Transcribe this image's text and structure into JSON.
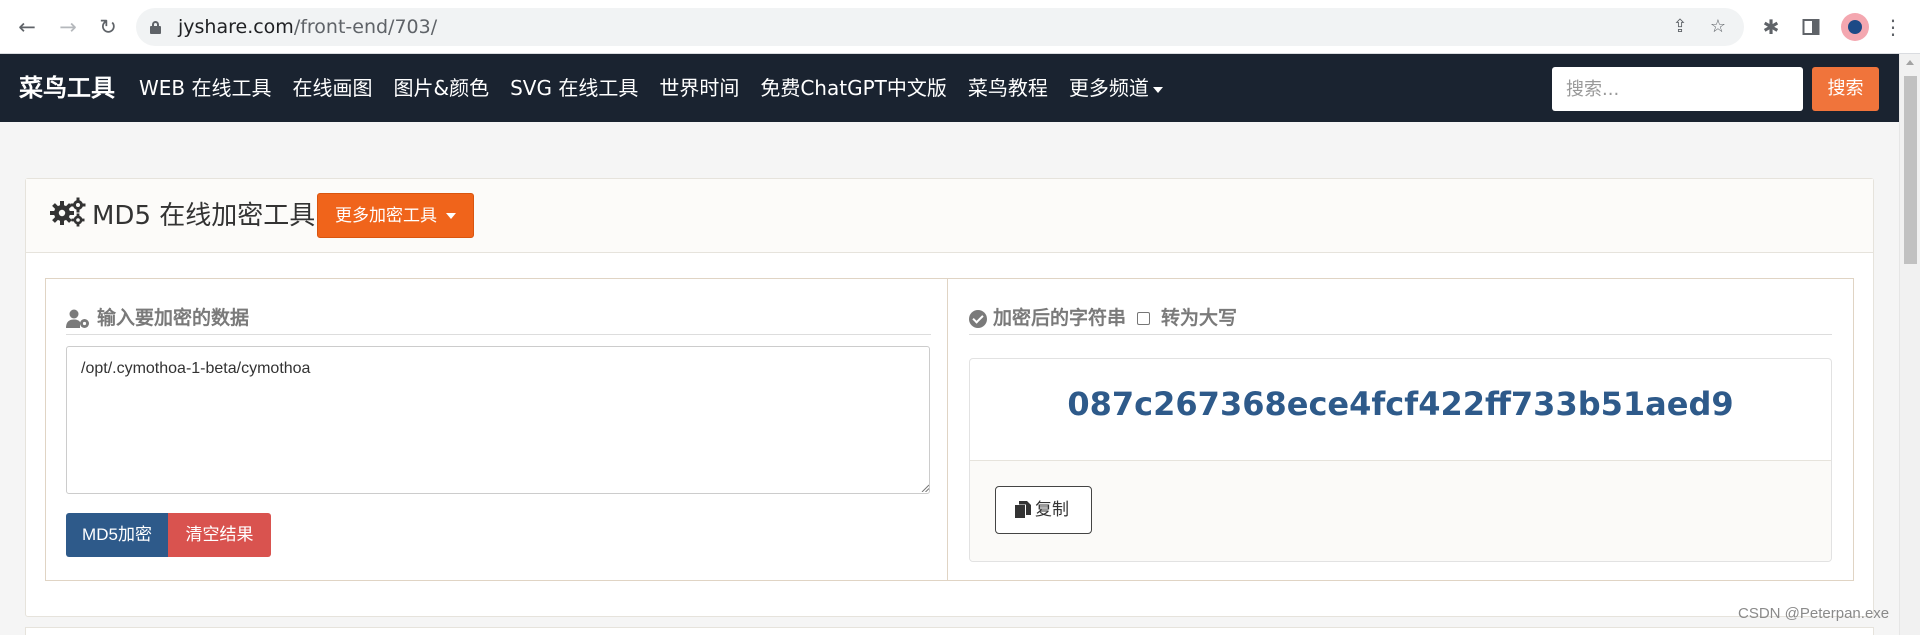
{
  "browser": {
    "url_domain": "jyshare.com",
    "url_path": "/front-end/703/",
    "back_glyph": "←",
    "forward_glyph": "→",
    "reload_glyph": "↻",
    "share_glyph": "⇪",
    "star_glyph": "☆",
    "extensions_glyph": "✱",
    "menu_glyph": "⋮"
  },
  "navbar": {
    "brand": "菜鸟工具",
    "links": [
      "WEB 在线工具",
      "在线画图",
      "图片&颜色",
      "SVG 在线工具",
      "世界时间",
      "免费ChatGPT中文版",
      "菜鸟教程",
      "更多频道"
    ],
    "search_placeholder": "搜索...",
    "search_button": "搜索"
  },
  "tool": {
    "title": "MD5 在线加密工具",
    "more_tools_label": "更多加密工具",
    "input_heading": "输入要加密的数据",
    "input_value": "/opt/.cymothoa-1-beta/cymothoa",
    "md5_button": "MD5加密",
    "clear_button": "清空结果",
    "output_heading": "加密后的字符串",
    "uppercase_label": "转为大写",
    "uppercase_checked": false,
    "hash_result": "087c267368ece4fcf422ff733b51aed9",
    "copy_button": "复制"
  },
  "watermark": "CSDN @Peterpan.exe",
  "colors": {
    "navbar_bg": "#1a2330",
    "accent_orange": "#f0641b",
    "search_orange": "#f0743b",
    "primary_blue": "#2e5a8a",
    "danger_red": "#d9534f"
  }
}
